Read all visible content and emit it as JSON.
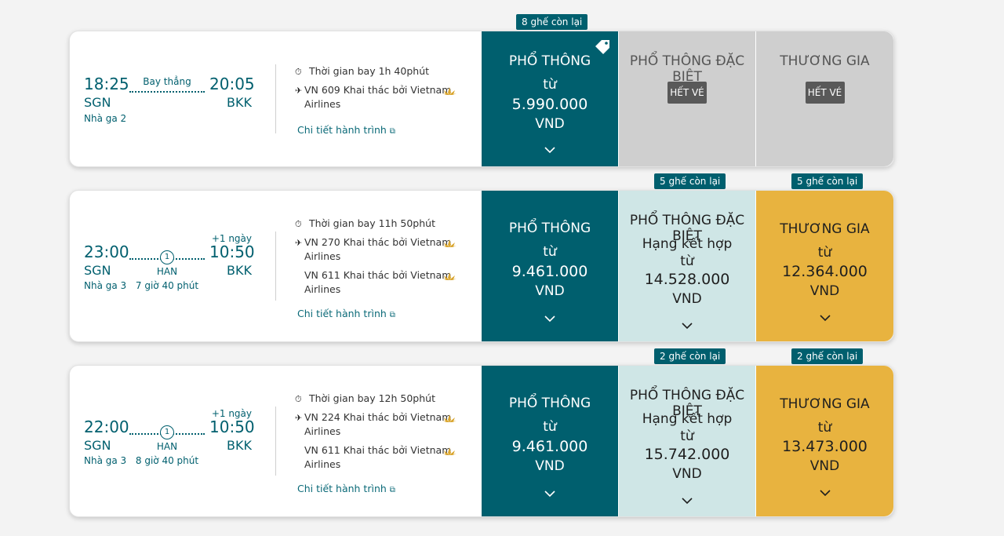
{
  "colors": {
    "primary": "#005f6e",
    "premium_economy": "#cfe6e6",
    "business": "#e8b33f",
    "unavailable": "#cfcfcf"
  },
  "flights": [
    {
      "dep_time": "18:25",
      "dep_code": "SGN",
      "dep_terminal": "Nhà ga 2",
      "arr_time": "20:05",
      "arr_code": "BKK",
      "route_label": "Bay thẳng",
      "duration": "Thời gian bay 1h 40phút",
      "segments": [
        {
          "flight": "VN 609 Khai thác bởi Vietnam",
          "airline": "Airlines"
        }
      ],
      "details_link": "Chi tiết hành trình",
      "economy": {
        "badge": "8 ghế còn lại",
        "title": "PHỔ THÔNG",
        "from": "từ",
        "price": "5.990.000",
        "currency": "VND"
      },
      "premium": {
        "title": "PHỔ THÔNG ĐẶC BIỆT",
        "soldout": "HẾT VÉ"
      },
      "business": {
        "title": "THƯƠNG GIA",
        "soldout": "HẾT VÉ"
      }
    },
    {
      "dep_time": "23:00",
      "dep_code": "SGN",
      "dep_terminal": "Nhà ga 3",
      "arr_time": "10:50",
      "arr_code": "BKK",
      "next_day": "+1 ngày",
      "stop_count": "1",
      "stop_code": "HAN",
      "layover": "7 giờ 40 phút",
      "duration": "Thời gian bay 11h 50phút",
      "segments": [
        {
          "flight": "VN 270 Khai thác bởi Vietnam",
          "airline": "Airlines"
        },
        {
          "flight": "VN 611 Khai thác bởi Vietnam",
          "airline": "Airlines"
        }
      ],
      "details_link": "Chi tiết hành trình",
      "economy": {
        "title": "PHỔ THÔNG",
        "from": "từ",
        "price": "9.461.000",
        "currency": "VND"
      },
      "premium": {
        "badge": "5 ghế còn lại",
        "title": "PHỔ THÔNG ĐẶC BIỆT",
        "subtitle": "Hạng kết hợp",
        "from": "từ",
        "price": "14.528.000",
        "currency": "VND"
      },
      "business": {
        "badge": "5 ghế còn lại",
        "title": "THƯƠNG GIA",
        "from": "từ",
        "price": "12.364.000",
        "currency": "VND"
      }
    },
    {
      "dep_time": "22:00",
      "dep_code": "SGN",
      "dep_terminal": "Nhà ga 3",
      "arr_time": "10:50",
      "arr_code": "BKK",
      "next_day": "+1 ngày",
      "stop_count": "1",
      "stop_code": "HAN",
      "layover": "8 giờ 40 phút",
      "duration": "Thời gian bay 12h 50phút",
      "segments": [
        {
          "flight": "VN 224 Khai thác bởi Vietnam",
          "airline": "Airlines"
        },
        {
          "flight": "VN 611 Khai thác bởi Vietnam",
          "airline": "Airlines"
        }
      ],
      "details_link": "Chi tiết hành trình",
      "economy": {
        "title": "PHỔ THÔNG",
        "from": "từ",
        "price": "9.461.000",
        "currency": "VND"
      },
      "premium": {
        "badge": "2 ghế còn lại",
        "title": "PHỔ THÔNG ĐẶC BIỆT",
        "subtitle": "Hạng kết hợp",
        "from": "từ",
        "price": "15.742.000",
        "currency": "VND"
      },
      "business": {
        "badge": "2 ghế còn lại",
        "title": "THƯƠNG GIA",
        "from": "từ",
        "price": "13.473.000",
        "currency": "VND"
      }
    }
  ]
}
